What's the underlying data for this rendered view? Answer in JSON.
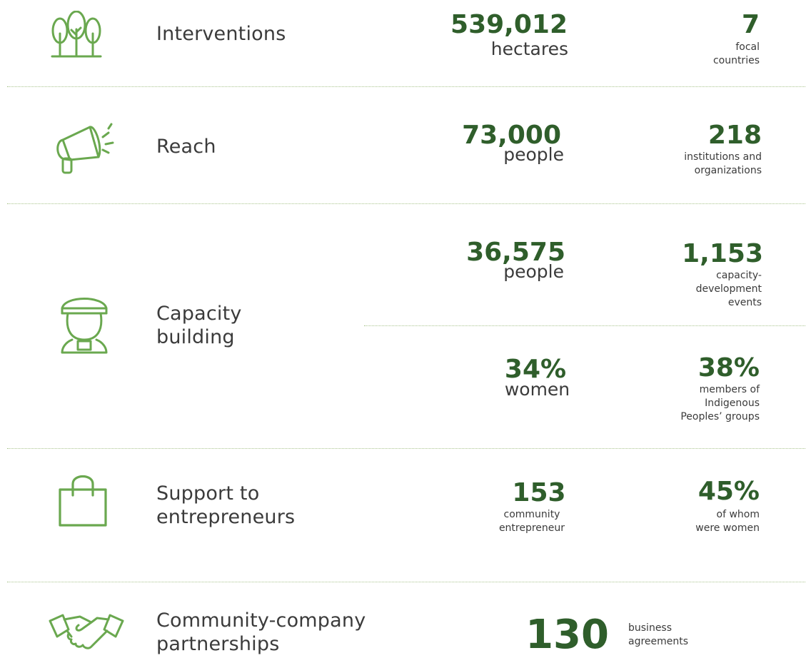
{
  "colors": {
    "accent": "#6aa84f",
    "number": "#2f5e2b",
    "divider": "#a9c48d"
  },
  "rows": [
    {
      "icon": "trees-icon",
      "label": "Interventions",
      "stat_a": {
        "value": "539,012",
        "unit": "hectares"
      },
      "stat_b": {
        "value": "7",
        "desc": [
          "focal",
          "countries"
        ]
      }
    },
    {
      "icon": "megaphone-icon",
      "label": "Reach",
      "stat_a": {
        "value": "73,000",
        "unit": "people"
      },
      "stat_b": {
        "value": "218",
        "desc": [
          "institutions and",
          "organizations"
        ]
      }
    },
    {
      "icon": "graduate-icon",
      "label": [
        "Capacity",
        "building"
      ],
      "stat_a": {
        "value": "36,575",
        "unit": "people"
      },
      "stat_b": {
        "value": "1,153",
        "desc": [
          "capacity-",
          "development",
          "events"
        ]
      },
      "stat_c": {
        "value": "34%",
        "unit": "women"
      },
      "stat_d": {
        "value": "38%",
        "desc": [
          "members of",
          "Indigenous",
          "Peoples’ groups"
        ]
      }
    },
    {
      "icon": "shopping-bag-icon",
      "label": [
        "Support to",
        "entrepreneurs"
      ],
      "stat_a": {
        "value": "153",
        "desc": [
          "community",
          "entrepreneur"
        ]
      },
      "stat_b": {
        "value": "45%",
        "desc": [
          "of whom",
          "were women"
        ]
      }
    },
    {
      "icon": "handshake-icon",
      "label": [
        "Community-company",
        "partnerships"
      ],
      "stat_a": {
        "value": "130",
        "desc": [
          "business",
          "agreements"
        ]
      }
    }
  ]
}
